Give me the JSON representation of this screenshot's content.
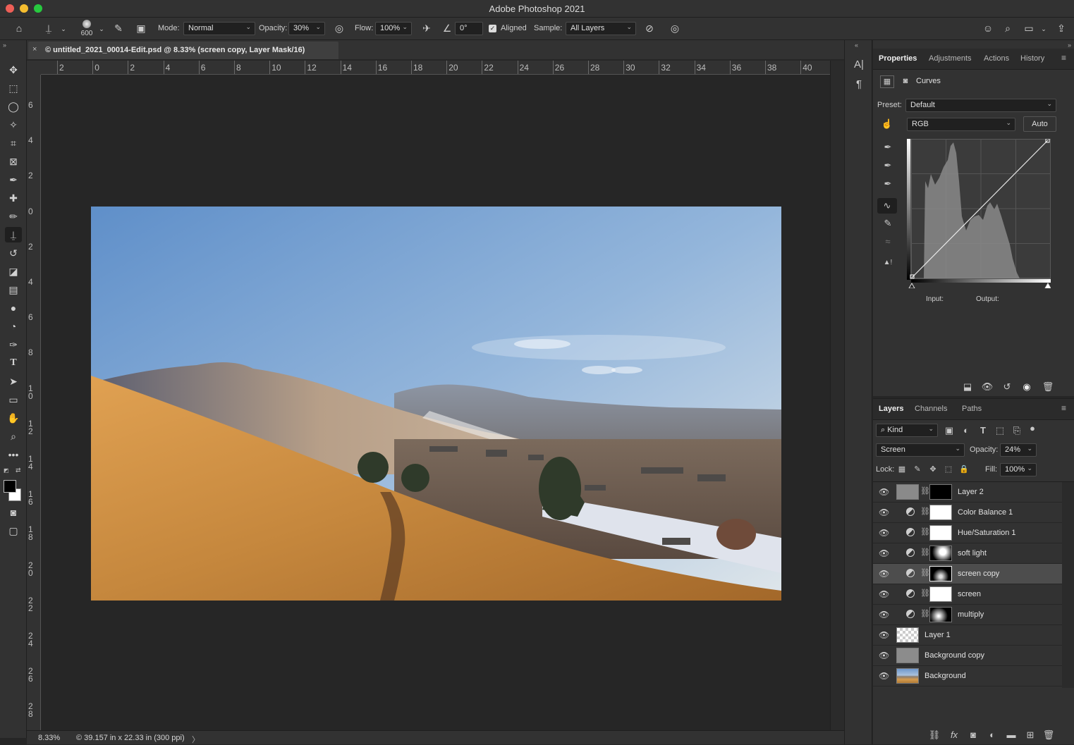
{
  "app": {
    "title": "Adobe Photoshop 2021"
  },
  "window_controls": {
    "close_color": "#ee5f57",
    "minimize_color": "#f5bd2f",
    "maximize_color": "#27c93f"
  },
  "options_bar": {
    "brush_size": "600",
    "mode_label": "Mode:",
    "mode_value": "Normal",
    "opacity_label": "Opacity:",
    "opacity_value": "30%",
    "flow_label": "Flow:",
    "flow_value": "100%",
    "angle_value": "0°",
    "aligned_label": "Aligned",
    "aligned_checked": true,
    "sample_label": "Sample:",
    "sample_value": "All Layers"
  },
  "document": {
    "tab_title": "© untitled_2021_00014-Edit.psd @ 8.33% (screen copy, Layer Mask/16)",
    "close_glyph": "×"
  },
  "ruler": {
    "h_labels": [
      "2",
      "0",
      "2",
      "4",
      "6",
      "8",
      "10",
      "12",
      "14",
      "16",
      "18",
      "20",
      "22",
      "24",
      "26",
      "28",
      "30",
      "32",
      "34",
      "36",
      "38",
      "40"
    ],
    "v_labels": [
      "6",
      "4",
      "2",
      "0",
      "2",
      "4",
      "6",
      "8",
      "10",
      "12",
      "14",
      "16",
      "18",
      "20",
      "22",
      "24",
      "26",
      "28"
    ]
  },
  "status": {
    "zoom": "8.33%",
    "doc_info": "© 39.157 in x 22.33 in (300 ppi)",
    "arrow": "〉"
  },
  "properties_panel": {
    "tabs": [
      "Properties",
      "Adjustments",
      "Actions",
      "History"
    ],
    "active_tab": "Properties",
    "adjustment_name": "Curves",
    "preset_label": "Preset:",
    "preset_value": "Default",
    "channel_value": "RGB",
    "auto_label": "Auto",
    "input_label": "Input:",
    "output_label": "Output:"
  },
  "layers_panel": {
    "tabs": [
      "Layers",
      "Channels",
      "Paths"
    ],
    "active_tab": "Layers",
    "filter_value": "Kind",
    "blend_mode": "Screen",
    "opacity_label": "Opacity:",
    "opacity_value": "24%",
    "lock_label": "Lock:",
    "fill_label": "Fill:",
    "fill_value": "100%",
    "layers": [
      {
        "name": "Layer 2",
        "kind": "pixel-mask",
        "selected": false
      },
      {
        "name": "Color Balance 1",
        "kind": "adjustment",
        "selected": false
      },
      {
        "name": "Hue/Saturation 1",
        "kind": "adjustment",
        "selected": false
      },
      {
        "name": "soft light",
        "kind": "adjustment",
        "selected": false
      },
      {
        "name": "screen copy",
        "kind": "adjustment",
        "selected": true
      },
      {
        "name": "screen",
        "kind": "adjustment",
        "selected": false
      },
      {
        "name": "multiply",
        "kind": "adjustment",
        "selected": false
      },
      {
        "name": "Layer 1",
        "kind": "transparent",
        "selected": false
      },
      {
        "name": "Background copy",
        "kind": "gray",
        "selected": false
      },
      {
        "name": "Background",
        "kind": "photo",
        "selected": false
      }
    ]
  },
  "colors": {
    "foreground": "#000000",
    "background": "#ffffff"
  }
}
